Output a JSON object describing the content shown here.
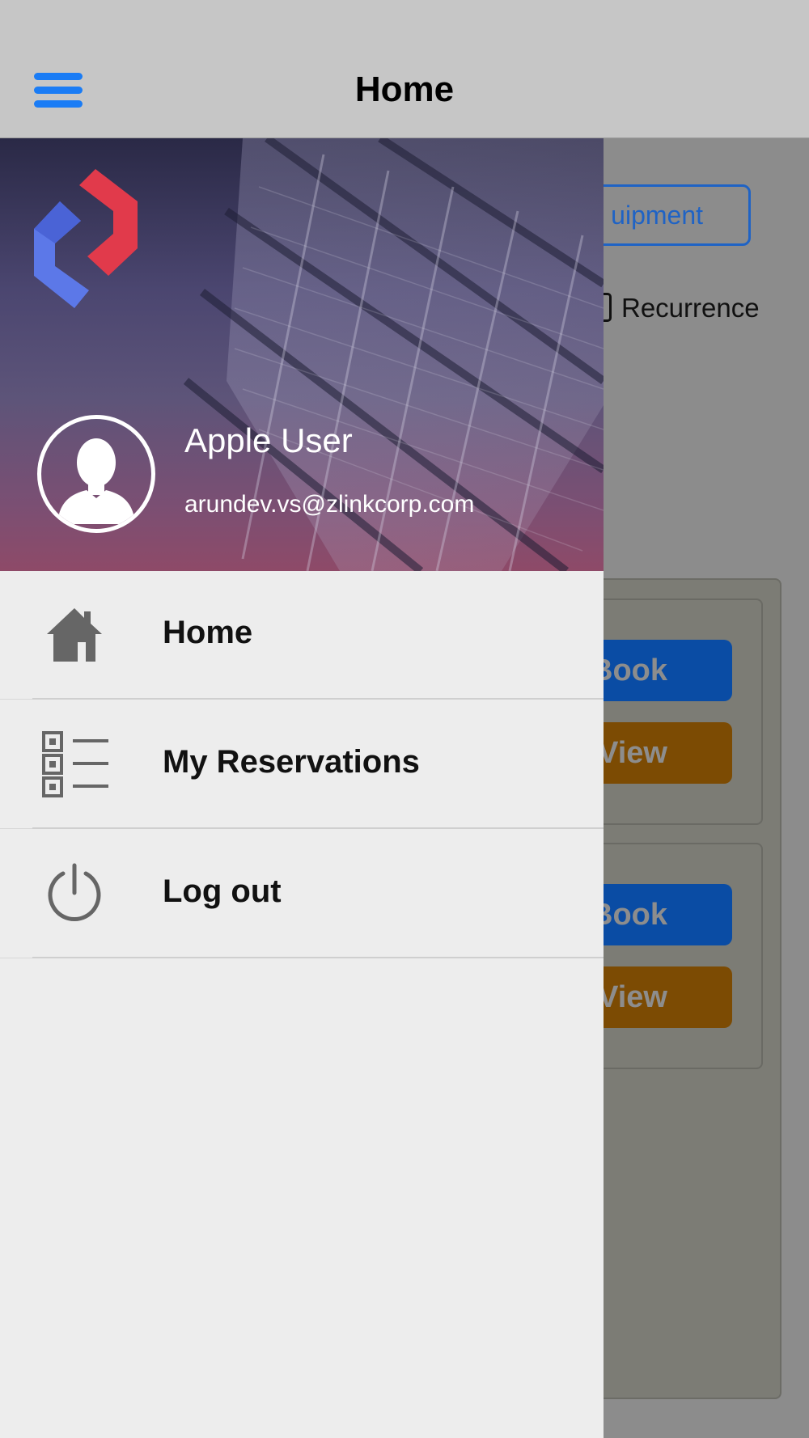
{
  "navbar": {
    "title": "Home",
    "menu_icon": "hamburger-menu-icon",
    "accent_color": "#1a7cf5"
  },
  "background": {
    "equipment_button_label": "uipment",
    "recurrence_label": "Recurrence",
    "cards": [
      {
        "book_label": "Book",
        "view_label": "View"
      },
      {
        "book_label": "Book",
        "view_label": "View"
      }
    ]
  },
  "drawer": {
    "user": {
      "name": "Apple User",
      "email": "arundev.vs@zlinkcorp.com",
      "avatar_icon": "user-avatar-icon"
    },
    "logo_colors": {
      "red": "#e13a4b",
      "blue": "#5c78e8"
    },
    "items": [
      {
        "label": "Home",
        "icon": "home-icon"
      },
      {
        "label": "My Reservations",
        "icon": "list-icon"
      },
      {
        "label": "Log out",
        "icon": "power-icon"
      }
    ]
  }
}
